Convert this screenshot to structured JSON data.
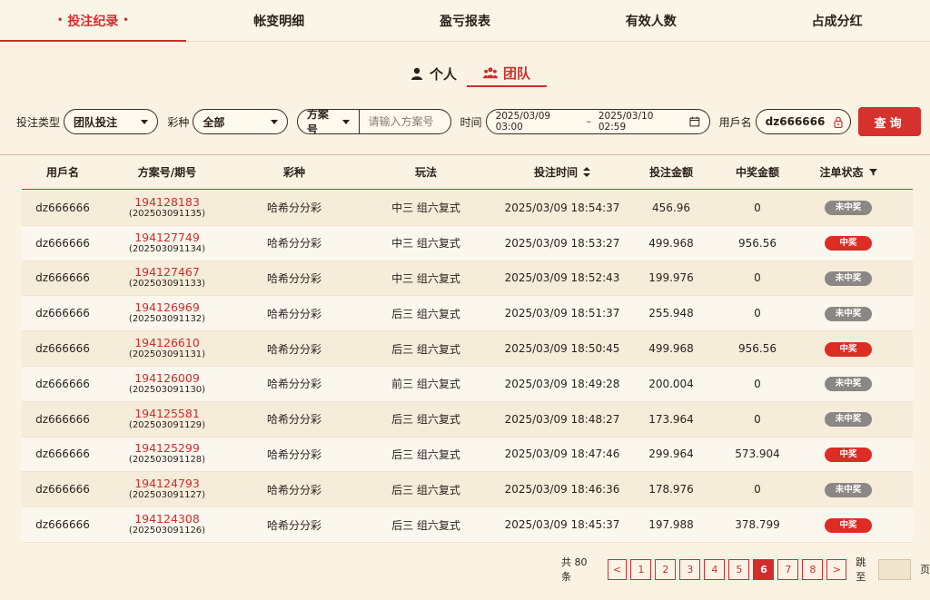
{
  "topnav": {
    "tabs": [
      {
        "label": "投注纪录",
        "active": true
      },
      {
        "label": "帐变明细",
        "active": false
      },
      {
        "label": "盈亏报表",
        "active": false
      },
      {
        "label": "有效人数",
        "active": false
      },
      {
        "label": "占成分红",
        "active": false
      }
    ],
    "dot": "•"
  },
  "modes": {
    "personal": "个人",
    "team": "团队"
  },
  "filters": {
    "bet_type_label": "投注类型",
    "bet_type_value": "团队投注",
    "lottery_label": "彩种",
    "lottery_value": "全部",
    "plan_label": "方案号",
    "plan_placeholder": "请输入方案号",
    "time_label": "时间",
    "date_start": "2025/03/09 03:00",
    "date_sep": "–",
    "date_end": "2025/03/10 02:59",
    "user_label": "用戶名",
    "user_value": "dz666666",
    "query_button": "查询"
  },
  "table": {
    "headers": [
      "用戶名",
      "方案号/期号",
      "彩种",
      "玩法",
      "投注时间",
      "投注金额",
      "中奖金额",
      "注单状态"
    ],
    "rows": [
      {
        "user": "dz666666",
        "bet_no": "194128183",
        "period": "(202503091135)",
        "lottery": "哈希分分彩",
        "play": "中三 组六复式",
        "time": "2025/03/09 18:54:37",
        "amount": "456.96",
        "win": "0",
        "status": "未中奖",
        "won": false
      },
      {
        "user": "dz666666",
        "bet_no": "194127749",
        "period": "(202503091134)",
        "lottery": "哈希分分彩",
        "play": "中三 组六复式",
        "time": "2025/03/09 18:53:27",
        "amount": "499.968",
        "win": "956.56",
        "status": "中奖",
        "won": true
      },
      {
        "user": "dz666666",
        "bet_no": "194127467",
        "period": "(202503091133)",
        "lottery": "哈希分分彩",
        "play": "中三 组六复式",
        "time": "2025/03/09 18:52:43",
        "amount": "199.976",
        "win": "0",
        "status": "未中奖",
        "won": false
      },
      {
        "user": "dz666666",
        "bet_no": "194126969",
        "period": "(202503091132)",
        "lottery": "哈希分分彩",
        "play": "后三 组六复式",
        "time": "2025/03/09 18:51:37",
        "amount": "255.948",
        "win": "0",
        "status": "未中奖",
        "won": false
      },
      {
        "user": "dz666666",
        "bet_no": "194126610",
        "period": "(202503091131)",
        "lottery": "哈希分分彩",
        "play": "后三 组六复式",
        "time": "2025/03/09 18:50:45",
        "amount": "499.968",
        "win": "956.56",
        "status": "中奖",
        "won": true
      },
      {
        "user": "dz666666",
        "bet_no": "194126009",
        "period": "(202503091130)",
        "lottery": "哈希分分彩",
        "play": "前三 组六复式",
        "time": "2025/03/09 18:49:28",
        "amount": "200.004",
        "win": "0",
        "status": "未中奖",
        "won": false
      },
      {
        "user": "dz666666",
        "bet_no": "194125581",
        "period": "(202503091129)",
        "lottery": "哈希分分彩",
        "play": "后三 组六复式",
        "time": "2025/03/09 18:48:27",
        "amount": "173.964",
        "win": "0",
        "status": "未中奖",
        "won": false
      },
      {
        "user": "dz666666",
        "bet_no": "194125299",
        "period": "(202503091128)",
        "lottery": "哈希分分彩",
        "play": "后三 组六复式",
        "time": "2025/03/09 18:47:46",
        "amount": "299.964",
        "win": "573.904",
        "status": "中奖",
        "won": true
      },
      {
        "user": "dz666666",
        "bet_no": "194124793",
        "period": "(202503091127)",
        "lottery": "哈希分分彩",
        "play": "后三 组六复式",
        "time": "2025/03/09 18:46:36",
        "amount": "178.976",
        "win": "0",
        "status": "未中奖",
        "won": false
      },
      {
        "user": "dz666666",
        "bet_no": "194124308",
        "period": "(202503091126)",
        "lottery": "哈希分分彩",
        "play": "后三 组六复式",
        "time": "2025/03/09 18:45:37",
        "amount": "197.988",
        "win": "378.799",
        "status": "中奖",
        "won": true
      }
    ]
  },
  "pager": {
    "total_text": "共 80 条",
    "prev": "<",
    "next": ">",
    "pages": [
      "1",
      "2",
      "3",
      "4",
      "5",
      "6",
      "7",
      "8"
    ],
    "current": "6",
    "jump_label": "跳至",
    "page_suffix": "页"
  },
  "colors": {
    "accent": "#d22c2c",
    "win_badge": "#dd2c24",
    "lose_badge": "#8b8784",
    "background": "#fbf4e6"
  }
}
